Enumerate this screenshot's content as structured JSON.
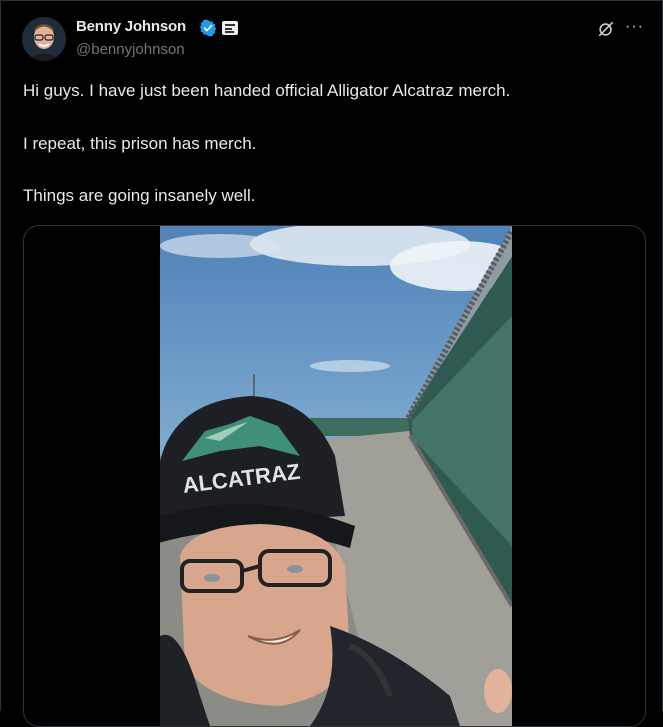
{
  "author": {
    "display_name": "Benny Johnson",
    "handle": "@bennyjohnson",
    "verified_icon": "verified-badge-icon",
    "affiliation_icon": "affiliate-badge-icon"
  },
  "actions": {
    "grok_icon": "grok-icon",
    "more_label": "···"
  },
  "tweet": {
    "lines": [
      "Hi guys. I have just been handed official Alligator Alcatraz merch.",
      "I repeat, this prison has merch.",
      "Things are going insanely well."
    ]
  },
  "media": {
    "cap_text": "ALCATRAZ"
  },
  "colors": {
    "background": "#000000",
    "text": "#e7e9ea",
    "secondary_text": "#71767b",
    "verified_blue": "#1d9bf0",
    "border": "#2f3336"
  }
}
